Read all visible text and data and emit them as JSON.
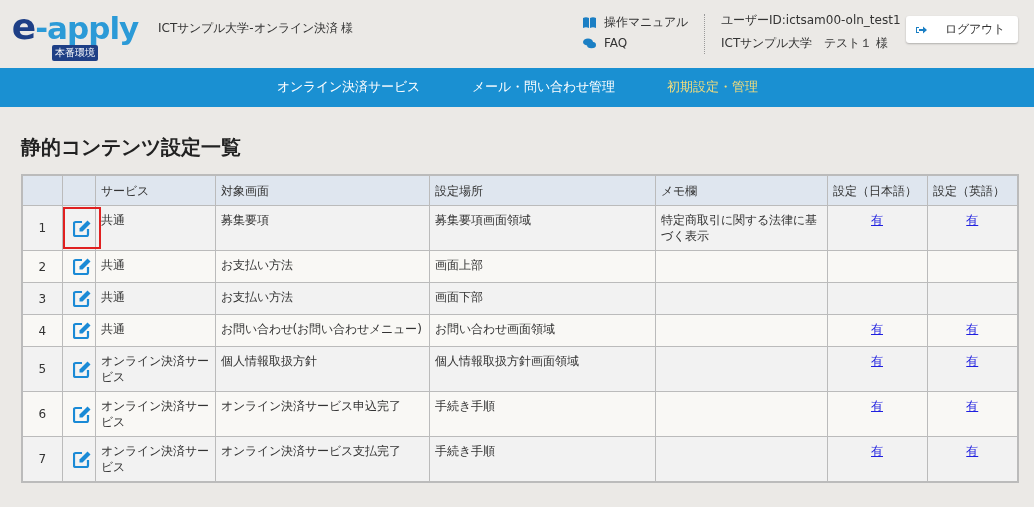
{
  "header": {
    "logo": {
      "part_1": "e",
      "part_2": "-apply"
    },
    "environment_badge": "本番環境",
    "organization": "ICTサンプル大学-オンライン決済 様",
    "links": [
      {
        "kind": "manual",
        "label": "操作マニュアル"
      },
      {
        "kind": "faq",
        "label": "FAQ"
      }
    ],
    "user_id": "ユーザーID:ictsam00-oln_test1",
    "user_name": "ICTサンプル大学　テスト１ 様",
    "logout_button": "ログアウト"
  },
  "nav": [
    {
      "label": "オンライン決済サービス",
      "selected": false
    },
    {
      "label": "メール・問い合わせ管理",
      "selected": false
    },
    {
      "label": "初期設定・管理",
      "selected": true
    }
  ],
  "page_title": "静的コンテンツ設定一覧",
  "table": {
    "columns": [
      "サービス",
      "対象画面",
      "設定場所",
      "メモ欄",
      "設定（日本語）",
      "設定（英語）"
    ],
    "rows": [
      {
        "number": "1",
        "highlighted": true,
        "service": "共通",
        "target": "募集要項",
        "location": "募集要項画面領域",
        "memo": "特定商取引に関する法律に基づく表示",
        "setting_ja": "有",
        "setting_en": "有"
      },
      {
        "number": "2",
        "highlighted": false,
        "service": "共通",
        "target": "お支払い方法",
        "location": "画面上部"
      },
      {
        "number": "3",
        "highlighted": false,
        "service": "共通",
        "target": "お支払い方法",
        "location": "画面下部"
      },
      {
        "number": "4",
        "highlighted": false,
        "service": "共通",
        "target": "お問い合わせ(お問い合わせメニュー)",
        "location": "お問い合わせ画面領域",
        "setting_ja": "有",
        "setting_en": "有"
      },
      {
        "number": "5",
        "highlighted": false,
        "service": "オンライン決済サービス",
        "target": "個人情報取扱方針",
        "location": "個人情報取扱方針画面領域",
        "setting_ja": "有",
        "setting_en": "有"
      },
      {
        "number": "6",
        "highlighted": false,
        "service": "オンライン決済サービス",
        "target": "オンライン決済サービス申込完了",
        "location": "手続き手順",
        "setting_ja": "有",
        "setting_en": "有"
      },
      {
        "number": "7",
        "highlighted": false,
        "service": "オンライン決済サービス",
        "target": "オンライン決済サービス支払完了",
        "location": "手続き手順",
        "setting_ja": "有",
        "setting_en": "有"
      }
    ]
  }
}
